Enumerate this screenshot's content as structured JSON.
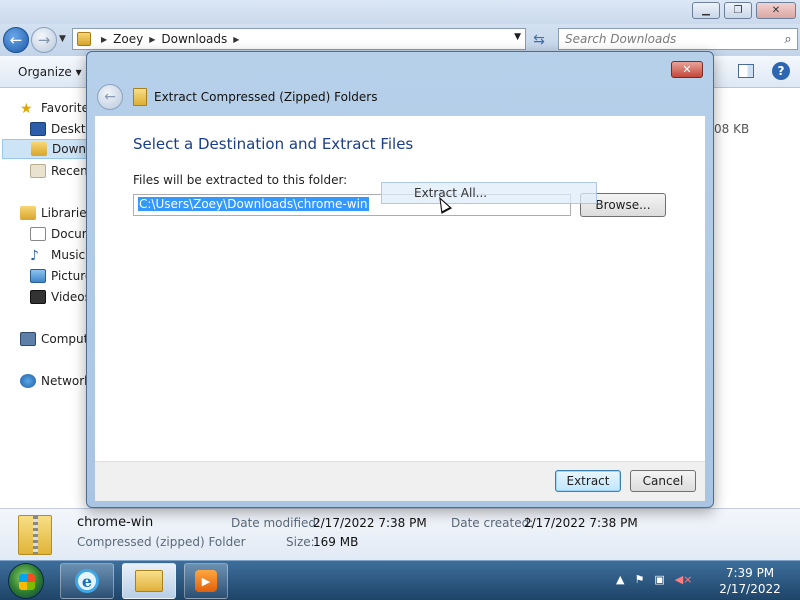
{
  "explorer": {
    "breadcrumbs": [
      "Zoey",
      "Downloads"
    ],
    "search_placeholder": "Search Downloads",
    "organize_label": "Organize",
    "nav": {
      "favorites": "Favorites",
      "desktop": "Deskto",
      "downloads": "Downl",
      "recent": "Recent",
      "libraries": "Libraries",
      "documents": "Docum",
      "music": "Music",
      "pictures": "Picture",
      "videos": "Videos",
      "computer": "Comput",
      "network": "Network"
    },
    "size_peek": "08 KB"
  },
  "dialog": {
    "title": "Extract Compressed (Zipped) Folders",
    "heading": "Select a Destination and Extract Files",
    "field_label": "Files will be extracted to this folder:",
    "path_value": "C:\\Users\\Zoey\\Downloads\\chrome-win",
    "browse_label": "Browse...",
    "drag_ghost_label": "Extract All...",
    "extract_label": "Extract",
    "cancel_label": "Cancel"
  },
  "details": {
    "name": "chrome-win",
    "type": "Compressed (zipped) Folder",
    "date_modified_label": "Date modified:",
    "date_modified": "2/17/2022 7:38 PM",
    "date_created_label": "Date created:",
    "date_created": "2/17/2022 7:38 PM",
    "size_label": "Size:",
    "size": "169 MB"
  },
  "taskbar": {
    "time": "7:39 PM",
    "date": "2/17/2022"
  },
  "icons": [
    "back-arrow-icon",
    "forward-arrow-icon",
    "folder-icon",
    "refresh-icon",
    "search-icon",
    "help-icon",
    "zip-folder-icon",
    "ie-icon",
    "media-player-icon",
    "flag-icon",
    "network-icon",
    "volume-muted-icon",
    "cursor-icon"
  ]
}
